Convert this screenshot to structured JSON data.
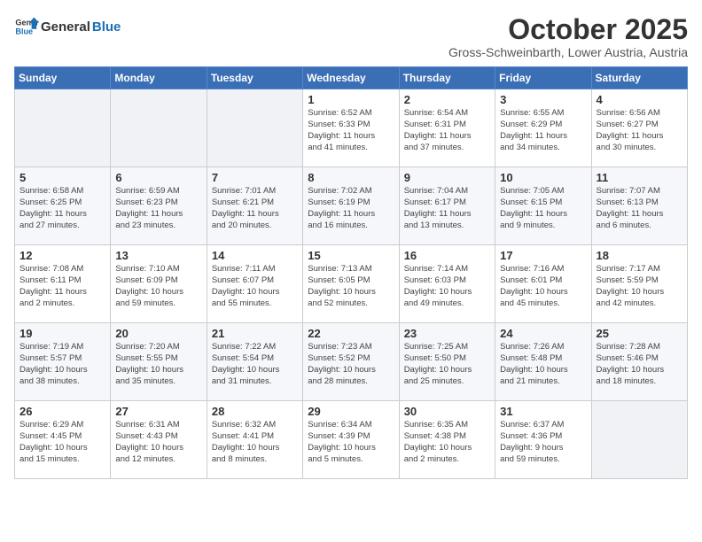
{
  "header": {
    "logo_line1": "General",
    "logo_line2": "Blue",
    "month": "October 2025",
    "location": "Gross-Schweinbarth, Lower Austria, Austria"
  },
  "weekdays": [
    "Sunday",
    "Monday",
    "Tuesday",
    "Wednesday",
    "Thursday",
    "Friday",
    "Saturday"
  ],
  "weeks": [
    [
      {
        "day": "",
        "text": ""
      },
      {
        "day": "",
        "text": ""
      },
      {
        "day": "",
        "text": ""
      },
      {
        "day": "1",
        "text": "Sunrise: 6:52 AM\nSunset: 6:33 PM\nDaylight: 11 hours\nand 41 minutes."
      },
      {
        "day": "2",
        "text": "Sunrise: 6:54 AM\nSunset: 6:31 PM\nDaylight: 11 hours\nand 37 minutes."
      },
      {
        "day": "3",
        "text": "Sunrise: 6:55 AM\nSunset: 6:29 PM\nDaylight: 11 hours\nand 34 minutes."
      },
      {
        "day": "4",
        "text": "Sunrise: 6:56 AM\nSunset: 6:27 PM\nDaylight: 11 hours\nand 30 minutes."
      }
    ],
    [
      {
        "day": "5",
        "text": "Sunrise: 6:58 AM\nSunset: 6:25 PM\nDaylight: 11 hours\nand 27 minutes."
      },
      {
        "day": "6",
        "text": "Sunrise: 6:59 AM\nSunset: 6:23 PM\nDaylight: 11 hours\nand 23 minutes."
      },
      {
        "day": "7",
        "text": "Sunrise: 7:01 AM\nSunset: 6:21 PM\nDaylight: 11 hours\nand 20 minutes."
      },
      {
        "day": "8",
        "text": "Sunrise: 7:02 AM\nSunset: 6:19 PM\nDaylight: 11 hours\nand 16 minutes."
      },
      {
        "day": "9",
        "text": "Sunrise: 7:04 AM\nSunset: 6:17 PM\nDaylight: 11 hours\nand 13 minutes."
      },
      {
        "day": "10",
        "text": "Sunrise: 7:05 AM\nSunset: 6:15 PM\nDaylight: 11 hours\nand 9 minutes."
      },
      {
        "day": "11",
        "text": "Sunrise: 7:07 AM\nSunset: 6:13 PM\nDaylight: 11 hours\nand 6 minutes."
      }
    ],
    [
      {
        "day": "12",
        "text": "Sunrise: 7:08 AM\nSunset: 6:11 PM\nDaylight: 11 hours\nand 2 minutes."
      },
      {
        "day": "13",
        "text": "Sunrise: 7:10 AM\nSunset: 6:09 PM\nDaylight: 10 hours\nand 59 minutes."
      },
      {
        "day": "14",
        "text": "Sunrise: 7:11 AM\nSunset: 6:07 PM\nDaylight: 10 hours\nand 55 minutes."
      },
      {
        "day": "15",
        "text": "Sunrise: 7:13 AM\nSunset: 6:05 PM\nDaylight: 10 hours\nand 52 minutes."
      },
      {
        "day": "16",
        "text": "Sunrise: 7:14 AM\nSunset: 6:03 PM\nDaylight: 10 hours\nand 49 minutes."
      },
      {
        "day": "17",
        "text": "Sunrise: 7:16 AM\nSunset: 6:01 PM\nDaylight: 10 hours\nand 45 minutes."
      },
      {
        "day": "18",
        "text": "Sunrise: 7:17 AM\nSunset: 5:59 PM\nDaylight: 10 hours\nand 42 minutes."
      }
    ],
    [
      {
        "day": "19",
        "text": "Sunrise: 7:19 AM\nSunset: 5:57 PM\nDaylight: 10 hours\nand 38 minutes."
      },
      {
        "day": "20",
        "text": "Sunrise: 7:20 AM\nSunset: 5:55 PM\nDaylight: 10 hours\nand 35 minutes."
      },
      {
        "day": "21",
        "text": "Sunrise: 7:22 AM\nSunset: 5:54 PM\nDaylight: 10 hours\nand 31 minutes."
      },
      {
        "day": "22",
        "text": "Sunrise: 7:23 AM\nSunset: 5:52 PM\nDaylight: 10 hours\nand 28 minutes."
      },
      {
        "day": "23",
        "text": "Sunrise: 7:25 AM\nSunset: 5:50 PM\nDaylight: 10 hours\nand 25 minutes."
      },
      {
        "day": "24",
        "text": "Sunrise: 7:26 AM\nSunset: 5:48 PM\nDaylight: 10 hours\nand 21 minutes."
      },
      {
        "day": "25",
        "text": "Sunrise: 7:28 AM\nSunset: 5:46 PM\nDaylight: 10 hours\nand 18 minutes."
      }
    ],
    [
      {
        "day": "26",
        "text": "Sunrise: 6:29 AM\nSunset: 4:45 PM\nDaylight: 10 hours\nand 15 minutes."
      },
      {
        "day": "27",
        "text": "Sunrise: 6:31 AM\nSunset: 4:43 PM\nDaylight: 10 hours\nand 12 minutes."
      },
      {
        "day": "28",
        "text": "Sunrise: 6:32 AM\nSunset: 4:41 PM\nDaylight: 10 hours\nand 8 minutes."
      },
      {
        "day": "29",
        "text": "Sunrise: 6:34 AM\nSunset: 4:39 PM\nDaylight: 10 hours\nand 5 minutes."
      },
      {
        "day": "30",
        "text": "Sunrise: 6:35 AM\nSunset: 4:38 PM\nDaylight: 10 hours\nand 2 minutes."
      },
      {
        "day": "31",
        "text": "Sunrise: 6:37 AM\nSunset: 4:36 PM\nDaylight: 9 hours\nand 59 minutes."
      },
      {
        "day": "",
        "text": ""
      }
    ]
  ]
}
